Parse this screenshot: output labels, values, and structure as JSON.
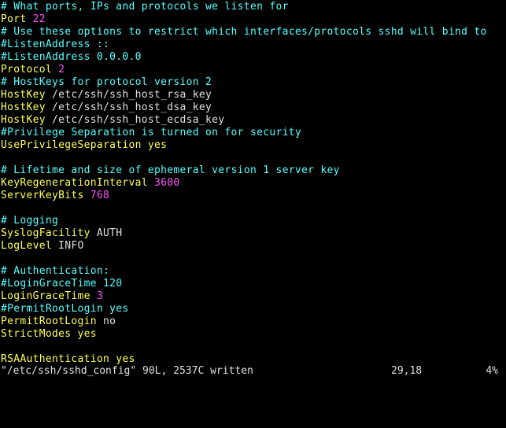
{
  "colors": {
    "background": "#000000",
    "comment": "#55ffff",
    "keyword": "#ffff55",
    "value": "#e0e0e0",
    "number": "#ff55ff"
  },
  "lines": [
    [
      {
        "t": "# What ports, IPs and protocols we listen for",
        "c": "comment"
      }
    ],
    [
      {
        "t": "Port ",
        "c": "key"
      },
      {
        "t": "22",
        "c": "num"
      }
    ],
    [
      {
        "t": "# Use these options to restrict which interfaces/protocols sshd will bind to",
        "c": "comment"
      }
    ],
    [
      {
        "t": "#ListenAddress ::",
        "c": "comment"
      }
    ],
    [
      {
        "t": "#ListenAddress 0.0.0.0",
        "c": "comment"
      }
    ],
    [
      {
        "t": "Protocol ",
        "c": "key"
      },
      {
        "t": "2",
        "c": "num"
      }
    ],
    [
      {
        "t": "# HostKeys for protocol version 2",
        "c": "comment"
      }
    ],
    [
      {
        "t": "HostKey ",
        "c": "key"
      },
      {
        "t": "/etc/ssh/ssh_host_rsa_key",
        "c": "val"
      }
    ],
    [
      {
        "t": "HostKey ",
        "c": "key"
      },
      {
        "t": "/etc/ssh/ssh_host_dsa_key",
        "c": "val"
      }
    ],
    [
      {
        "t": "HostKey ",
        "c": "key"
      },
      {
        "t": "/etc/ssh/ssh_host_ecdsa_key",
        "c": "val"
      }
    ],
    [
      {
        "t": "#Privilege Separation is turned on for security",
        "c": "comment"
      }
    ],
    [
      {
        "t": "UsePrivilegeSeparation ",
        "c": "key"
      },
      {
        "t": "yes",
        "c": "key"
      }
    ],
    [],
    [
      {
        "t": "# Lifetime and size of ephemeral version 1 server key",
        "c": "comment"
      }
    ],
    [
      {
        "t": "KeyRegenerationInterval ",
        "c": "key"
      },
      {
        "t": "3600",
        "c": "num"
      }
    ],
    [
      {
        "t": "ServerKeyBits ",
        "c": "key"
      },
      {
        "t": "768",
        "c": "num"
      }
    ],
    [],
    [
      {
        "t": "# Logging",
        "c": "comment"
      }
    ],
    [
      {
        "t": "SyslogFacility ",
        "c": "key"
      },
      {
        "t": "AUTH",
        "c": "val"
      }
    ],
    [
      {
        "t": "LogLevel ",
        "c": "key"
      },
      {
        "t": "INFO",
        "c": "val"
      }
    ],
    [],
    [
      {
        "t": "# Authentication:",
        "c": "comment"
      }
    ],
    [
      {
        "t": "#LoginGraceTime 120",
        "c": "comment"
      }
    ],
    [
      {
        "t": "LoginGraceTime ",
        "c": "key"
      },
      {
        "t": "3",
        "c": "num"
      }
    ],
    [
      {
        "t": "#PermitRootLogin yes",
        "c": "comment"
      }
    ],
    [
      {
        "t": "PermitRootLogin ",
        "c": "key"
      },
      {
        "t": "no",
        "c": "val"
      }
    ],
    [
      {
        "t": "StrictModes ",
        "c": "key"
      },
      {
        "t": "yes",
        "c": "key"
      }
    ],
    [],
    [
      {
        "t": "RSAAuthentication ",
        "c": "key"
      },
      {
        "t": "yes",
        "c": "key"
      }
    ]
  ],
  "status": {
    "message": "\"/etc/ssh/sshd_config\" 90L, 2537C written",
    "position": "29,18",
    "percent": "4%"
  }
}
